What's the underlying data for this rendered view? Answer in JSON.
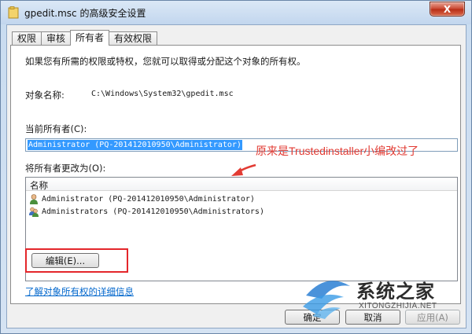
{
  "window": {
    "title": "gpedit.msc 的高级安全设置",
    "close_label": "X"
  },
  "tabs": [
    {
      "label": "权限"
    },
    {
      "label": "审核"
    },
    {
      "label": "所有者",
      "active": true
    },
    {
      "label": "有效权限"
    }
  ],
  "owner_tab": {
    "intro": "如果您有所需的权限或特权，您就可以取得或分配这个对象的所有权。",
    "object_name_label": "对象名称:",
    "object_name_value": "C:\\Windows\\System32\\gpedit.msc",
    "current_owner_label": "当前所有者(C):",
    "current_owner_value": "Administrator (PQ-201412010950\\Administrator)",
    "change_owner_label": "将所有者更改为(O):",
    "list_column": "名称",
    "owner_candidates": [
      {
        "name": "Administrator (PQ-201412010950\\Administrator)",
        "icon": "user-icon"
      },
      {
        "name": "Administrators (PQ-201412010950\\Administrators)",
        "icon": "group-icon"
      }
    ],
    "edit_button": "编辑(E)...",
    "learn_more_link": "了解对象所有权的详细信息"
  },
  "annotation": {
    "text": "原来是Trustedinstaller小编改过了",
    "color": "#e23b33"
  },
  "footer": {
    "ok_label": "确定",
    "cancel_label": "取消",
    "apply_label": "应用(A)"
  },
  "watermark": {
    "brand_cn": "系统之家",
    "brand_en": "XITONGZHIJIA.NET"
  }
}
